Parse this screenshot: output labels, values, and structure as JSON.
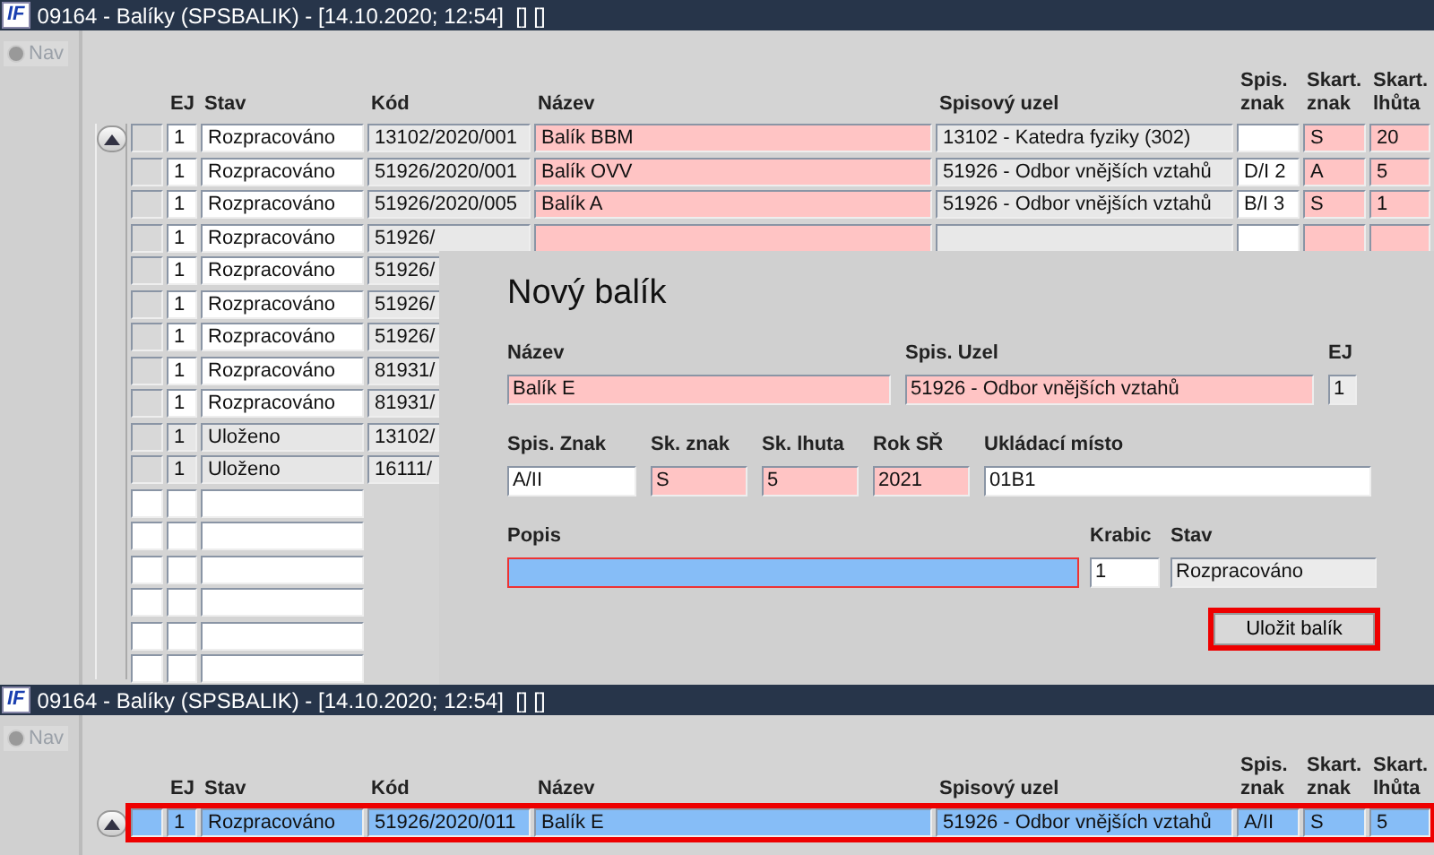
{
  "windows": [
    {
      "logo": "IF",
      "title": "09164 - Balíky (SPSBALIK) - [14.10.2020; 12:54]  [] []",
      "nav": "Nav",
      "nav_selected": false,
      "columns": [
        "EJ",
        "Stav",
        "Kód",
        "Název",
        "Spisový uzel",
        "Spis.\nznak",
        "Skart.\nznak",
        "Skart.\nlhůta"
      ],
      "rows": [
        {
          "kind": "open",
          "selected": false,
          "ej": "1",
          "stav": "Rozpracováno",
          "kod": "13102/2020/001",
          "nazev": "Balík BBM",
          "uzel": "13102 - Katedra  fyziky (302)",
          "spis_znak": "",
          "skart_znak": "S",
          "skart_lhuta": "20"
        },
        {
          "kind": "open",
          "selected": false,
          "ej": "1",
          "stav": "Rozpracováno",
          "kod": "51926/2020/001",
          "nazev": "Balík OVV",
          "uzel": "51926 - Odbor vnějších vztahů",
          "spis_znak": "D/I 2",
          "skart_znak": "A",
          "skart_lhuta": "5"
        },
        {
          "kind": "open",
          "selected": false,
          "ej": "1",
          "stav": "Rozpracováno",
          "kod": "51926/2020/005",
          "nazev": "Balík A",
          "uzel": "51926 - Odbor vnějších vztahů",
          "spis_znak": "B/I 3",
          "skart_znak": "S",
          "skart_lhuta": "1"
        },
        {
          "kind": "open",
          "selected": false,
          "ej": "1",
          "stav": "Rozpracováno",
          "kod": "51926/"
        },
        {
          "kind": "open",
          "selected": false,
          "ej": "1",
          "stav": "Rozpracováno",
          "kod": "51926/"
        },
        {
          "kind": "open",
          "selected": false,
          "ej": "1",
          "stav": "Rozpracováno",
          "kod": "51926/"
        },
        {
          "kind": "open",
          "selected": false,
          "ej": "1",
          "stav": "Rozpracováno",
          "kod": "51926/"
        },
        {
          "kind": "open",
          "selected": false,
          "ej": "1",
          "stav": "Rozpracováno",
          "kod": "81931/"
        },
        {
          "kind": "open",
          "selected": false,
          "ej": "1",
          "stav": "Rozpracováno",
          "kod": "81931/"
        },
        {
          "kind": "stored",
          "selected": false,
          "ej": "1",
          "stav": "Uloženo",
          "kod": "13102/"
        },
        {
          "kind": "stored",
          "selected": false,
          "ej": "1",
          "stav": "Uloženo",
          "kod": "16111/"
        },
        {
          "kind": "empty",
          "selected": false
        },
        {
          "kind": "empty",
          "selected": false
        },
        {
          "kind": "empty",
          "selected": false
        },
        {
          "kind": "empty",
          "selected": false
        },
        {
          "kind": "empty",
          "selected": false
        },
        {
          "kind": "empty",
          "selected": false
        }
      ]
    },
    {
      "logo": "IF",
      "title": "09164 - Balíky (SPSBALIK) - [14.10.2020; 12:54]  [] []",
      "nav": "Nav",
      "nav_selected": false,
      "columns": [
        "EJ",
        "Stav",
        "Kód",
        "Název",
        "Spisový uzel",
        "Spis.\nznak",
        "Skart.\nznak",
        "Skart.\nlhůta"
      ],
      "rows": [
        {
          "kind": "open",
          "selected": true,
          "highlighted": true,
          "ej": "1",
          "stav": "Rozpracováno",
          "kod": "51926/2020/011",
          "nazev": "Balík E",
          "uzel": "51926 - Odbor vnějších vztahů",
          "spis_znak": "A/II",
          "skart_znak": "S",
          "skart_lhuta": "5"
        }
      ]
    }
  ],
  "dialog": {
    "title": "Nový balík",
    "rows": [
      [
        {
          "label": "Název",
          "value": "Balík E",
          "kind": "required"
        },
        {
          "label": "Spis. Uzel",
          "value": "51926 - Odbor vnějších vztahů",
          "kind": "required"
        },
        {
          "label": "EJ",
          "value": "1",
          "kind": "readonly"
        }
      ],
      [
        {
          "label": "Spis. Znak",
          "value": "A/II",
          "kind": "plain"
        },
        {
          "label": "Sk. znak",
          "value": "S",
          "kind": "required"
        },
        {
          "label": "Sk. lhuta",
          "value": "5",
          "kind": "required"
        },
        {
          "label": "Rok SŘ",
          "value": "2021",
          "kind": "required"
        },
        {
          "label": "Ukládací místo",
          "value": "01B1",
          "kind": "plain"
        }
      ],
      [
        {
          "label": "Popis",
          "kind": "focused"
        },
        {
          "label": "Krabic",
          "value": "1",
          "kind": "plain"
        },
        {
          "label": "Stav",
          "value": "Rozpracováno",
          "kind": "readonly"
        }
      ]
    ],
    "save_button": {
      "label": "Uložit balík",
      "highlighted": true
    }
  }
}
